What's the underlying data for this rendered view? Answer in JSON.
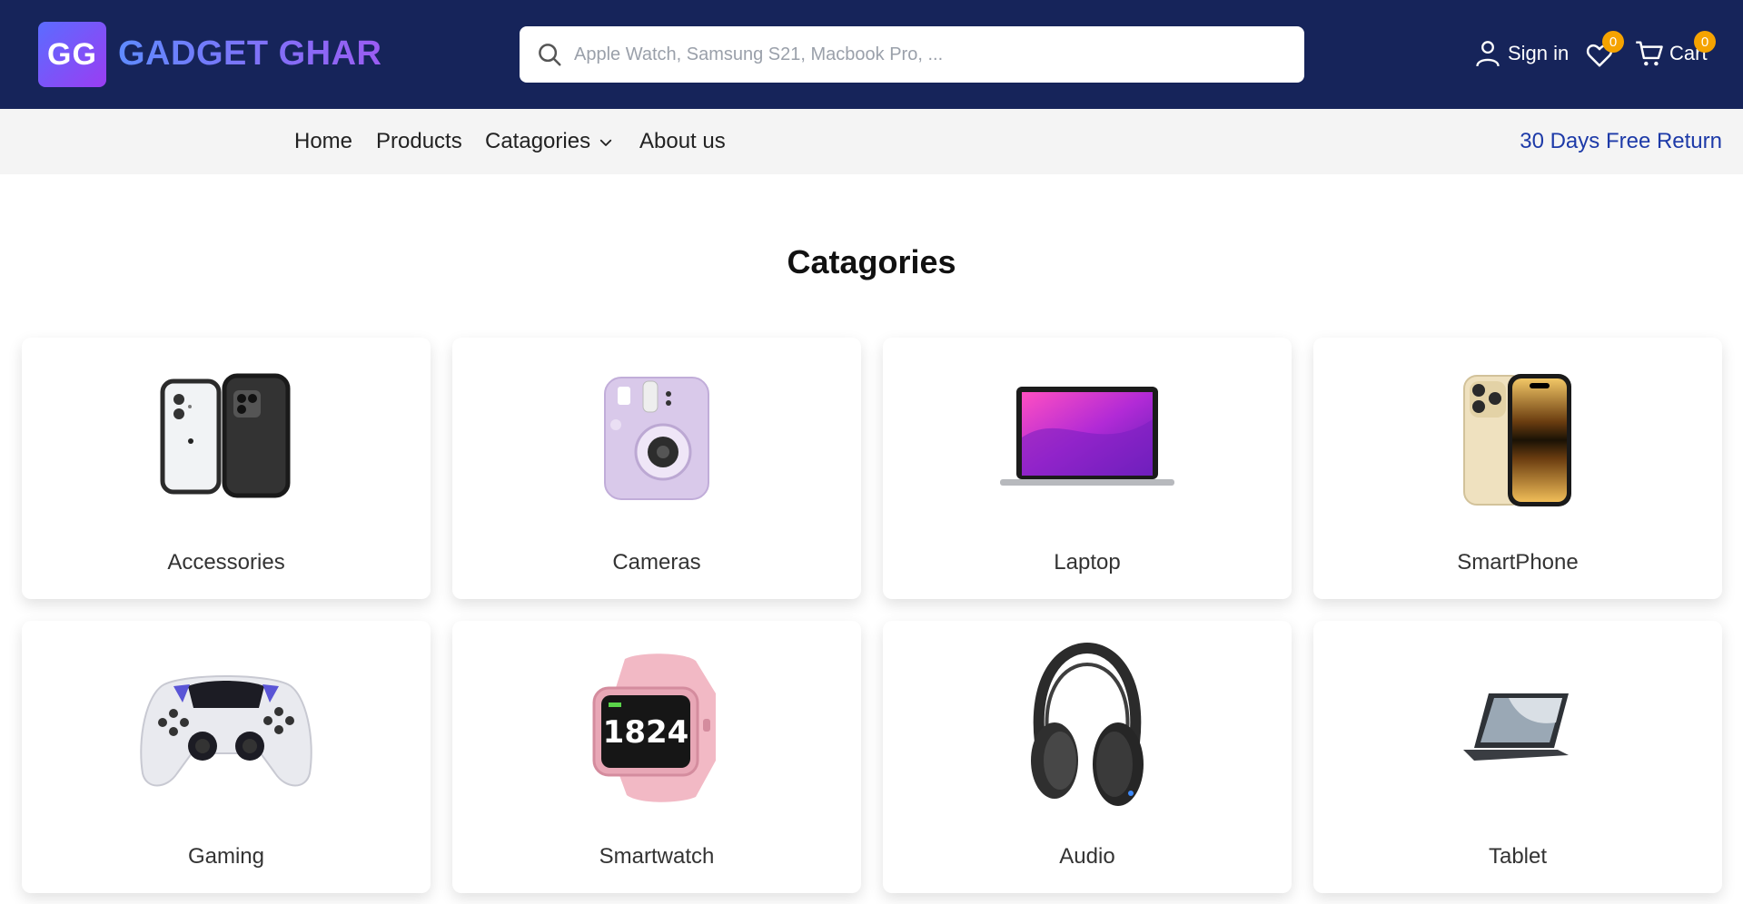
{
  "brand": {
    "initials": "GG",
    "name": "GADGET GHAR"
  },
  "search": {
    "placeholder": "Apple Watch, Samsung S21, Macbook Pro, ..."
  },
  "header": {
    "signin_label": "Sign in",
    "wishlist_count": "0",
    "cart_label": "Cart",
    "cart_count": "0"
  },
  "nav": {
    "items": [
      "Home",
      "Products",
      "Catagories",
      "About us"
    ],
    "promo": "30 Days Free Return"
  },
  "section": {
    "title": "Catagories"
  },
  "categories": [
    {
      "label": "Accessories",
      "icon": "phone-case-icon"
    },
    {
      "label": "Cameras",
      "icon": "instant-camera-icon"
    },
    {
      "label": "Laptop",
      "icon": "laptop-icon"
    },
    {
      "label": "SmartPhone",
      "icon": "smartphone-icon"
    },
    {
      "label": "Gaming",
      "icon": "game-controller-icon"
    },
    {
      "label": "Smartwatch",
      "icon": "smartwatch-icon"
    },
    {
      "label": "Audio",
      "icon": "headphones-icon"
    },
    {
      "label": "Tablet",
      "icon": "tablet-icon"
    }
  ],
  "colors": {
    "header_bg": "#16245a",
    "nav_bg": "#f4f4f4",
    "badge": "#f5a300",
    "promo": "#1d3aa8",
    "logo_gradient_start": "#5b6cff",
    "logo_gradient_end": "#9a3df2"
  }
}
